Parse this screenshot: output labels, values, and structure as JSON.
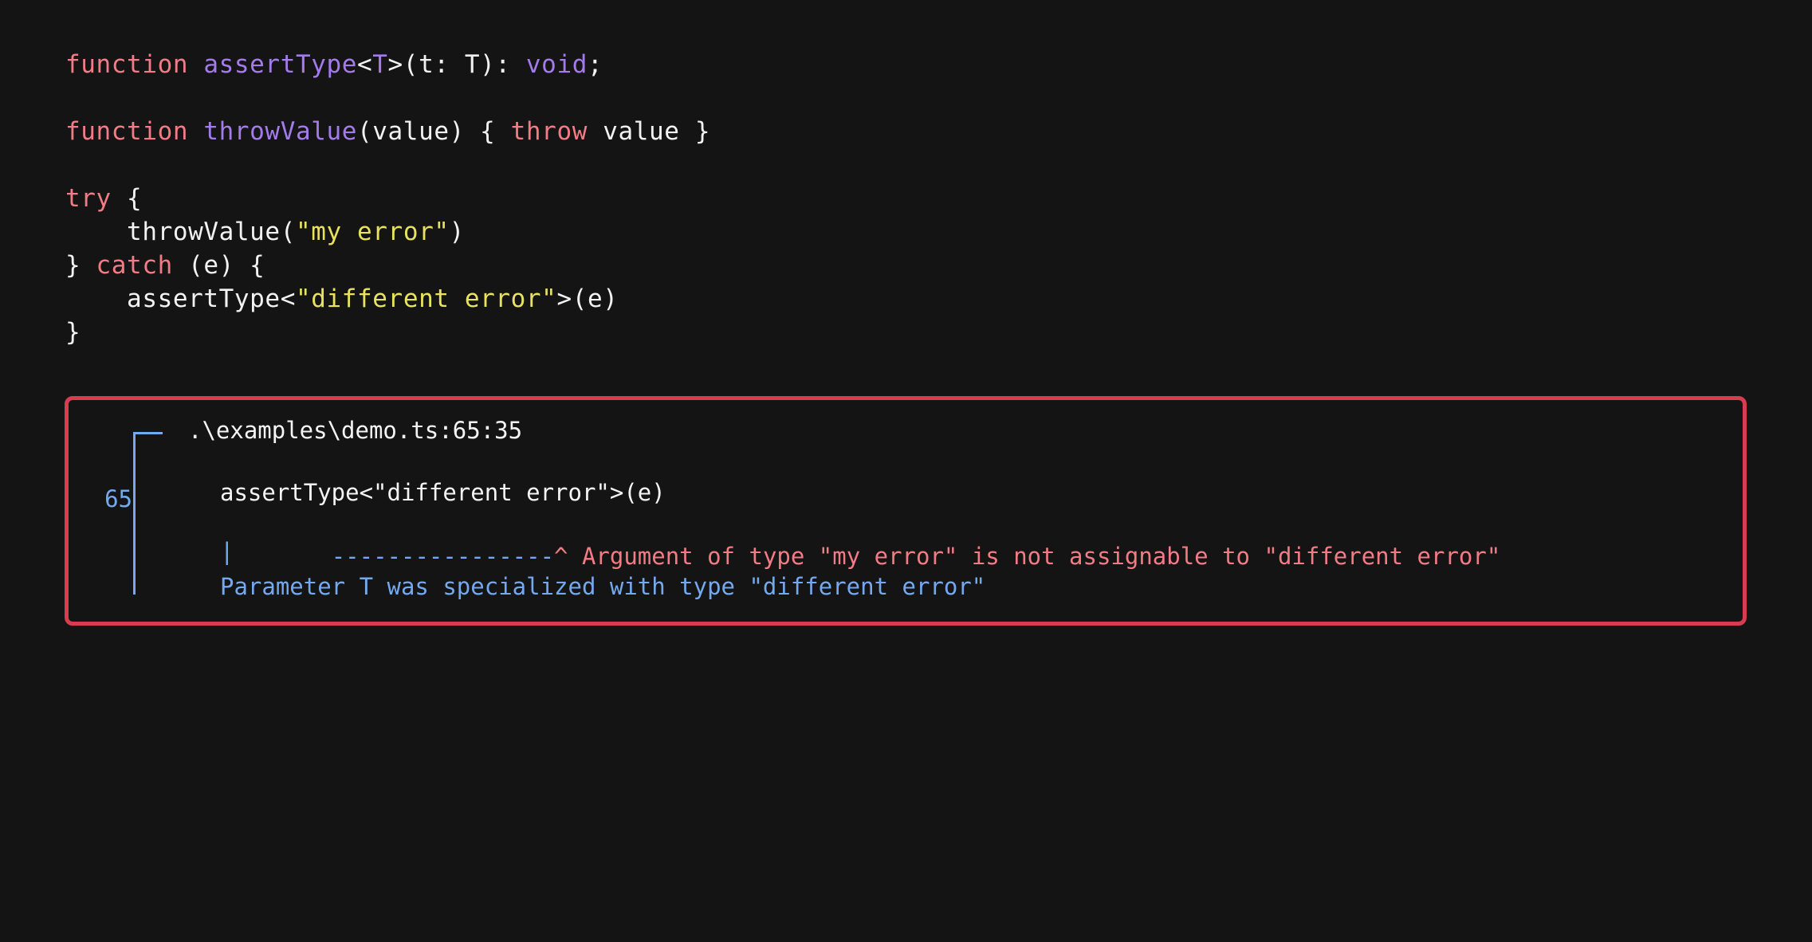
{
  "theme": {
    "background": "#141414",
    "foreground": "#f2f2f3",
    "keyword_color": "#f27b85",
    "identifier_color": "#a47bea",
    "string_color": "#e8e261",
    "error_border_color": "#d93c50",
    "info_blue": "#74a9f0"
  },
  "code": {
    "lines": [
      {
        "tokens": [
          {
            "text": "function",
            "kind": "keyword"
          },
          {
            "text": " ",
            "kind": "plain"
          },
          {
            "text": "assertType",
            "kind": "identifier"
          },
          {
            "text": "<",
            "kind": "plain"
          },
          {
            "text": "T",
            "kind": "identifier"
          },
          {
            "text": ">(t: T): ",
            "kind": "plain"
          },
          {
            "text": "void",
            "kind": "identifier"
          },
          {
            "text": ";",
            "kind": "plain"
          }
        ]
      },
      {
        "tokens": []
      },
      {
        "tokens": [
          {
            "text": "function",
            "kind": "keyword"
          },
          {
            "text": " ",
            "kind": "plain"
          },
          {
            "text": "throwValue",
            "kind": "identifier"
          },
          {
            "text": "(value) { ",
            "kind": "plain"
          },
          {
            "text": "throw",
            "kind": "keyword"
          },
          {
            "text": " value }",
            "kind": "plain"
          }
        ]
      },
      {
        "tokens": []
      },
      {
        "tokens": [
          {
            "text": "try",
            "kind": "keyword"
          },
          {
            "text": " {",
            "kind": "plain"
          }
        ]
      },
      {
        "tokens": [
          {
            "text": "    throwValue(",
            "kind": "plain"
          },
          {
            "text": "\"my error\"",
            "kind": "string"
          },
          {
            "text": ")",
            "kind": "plain"
          }
        ]
      },
      {
        "tokens": [
          {
            "text": "} ",
            "kind": "plain"
          },
          {
            "text": "catch",
            "kind": "keyword"
          },
          {
            "text": " (e) {",
            "kind": "plain"
          }
        ]
      },
      {
        "tokens": [
          {
            "text": "    assertType<",
            "kind": "plain"
          },
          {
            "text": "\"different error\"",
            "kind": "string"
          },
          {
            "text": ">(e)",
            "kind": "plain"
          }
        ]
      },
      {
        "tokens": [
          {
            "text": "}",
            "kind": "plain"
          }
        ]
      }
    ]
  },
  "diagnostic": {
    "file_path": ".\\examples\\demo.ts:65:35",
    "line_number": "65",
    "snippet": "assertType<\"different error\">(e)",
    "underline_dashes": "----------------",
    "caret_message": "^ Argument of type \"my error\" is not assignable to \"different error\"",
    "pipe": "|",
    "note": "Parameter T was specialized with type \"different error\""
  }
}
